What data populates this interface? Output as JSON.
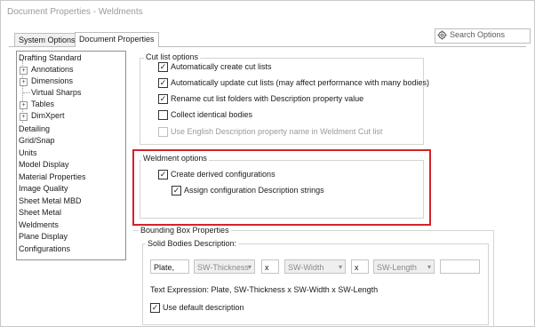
{
  "window": {
    "title": "Document Properties - Weldments"
  },
  "tabs": [
    {
      "label": "System Options"
    },
    {
      "label": "Document Properties"
    }
  ],
  "search": {
    "label": "Search Options"
  },
  "tree": {
    "items": [
      {
        "label": "Drafting Standard"
      },
      {
        "label": "Annotations"
      },
      {
        "label": "Dimensions"
      },
      {
        "label": "Virtual Sharps"
      },
      {
        "label": "Tables"
      },
      {
        "label": "DimXpert"
      },
      {
        "label": "Detailing"
      },
      {
        "label": "Grid/Snap"
      },
      {
        "label": "Units"
      },
      {
        "label": "Model Display"
      },
      {
        "label": "Material Properties"
      },
      {
        "label": "Image Quality"
      },
      {
        "label": "Sheet Metal MBD"
      },
      {
        "label": "Sheet Metal"
      },
      {
        "label": "Weldments"
      },
      {
        "label": "Plane Display"
      },
      {
        "label": "Configurations"
      }
    ],
    "expander_symbol": "+"
  },
  "cut_list": {
    "title": "Cut list options",
    "options": [
      {
        "label": "Automatically create cut lists",
        "checked": true,
        "enabled": true
      },
      {
        "label": "Automatically update cut lists (may affect performance with many bodies)",
        "checked": true,
        "enabled": true
      },
      {
        "label": "Rename cut list folders with Description property value",
        "checked": true,
        "enabled": true
      },
      {
        "label": "Collect identical bodies",
        "checked": false,
        "enabled": true
      },
      {
        "label": "Use English Description property name in Weldment Cut list",
        "checked": false,
        "enabled": false
      }
    ]
  },
  "weldment": {
    "title": "Weldment options",
    "options": [
      {
        "label": "Create derived configurations",
        "checked": true
      },
      {
        "label": "Assign configuration Description strings",
        "checked": true
      }
    ],
    "highlight_color": "#d6212a"
  },
  "bounding_box": {
    "title": "Bounding Box Properties",
    "solid_bodies_title": "Solid Bodies Description:",
    "prefix_value": "Plate,",
    "thickness_combo": "SW-Thickness",
    "separator1": "x",
    "width_combo": "SW-Width",
    "separator2": "x",
    "length_combo": "SW-Length",
    "suffix_value": "",
    "expression": "Text Expression: Plate, SW-Thickness x SW-Width x SW-Length",
    "default_description": {
      "label": "Use default description",
      "checked": true
    }
  },
  "icons": {
    "search": "gear-search-icon",
    "check": "✓",
    "combo_arrow": "▾"
  }
}
